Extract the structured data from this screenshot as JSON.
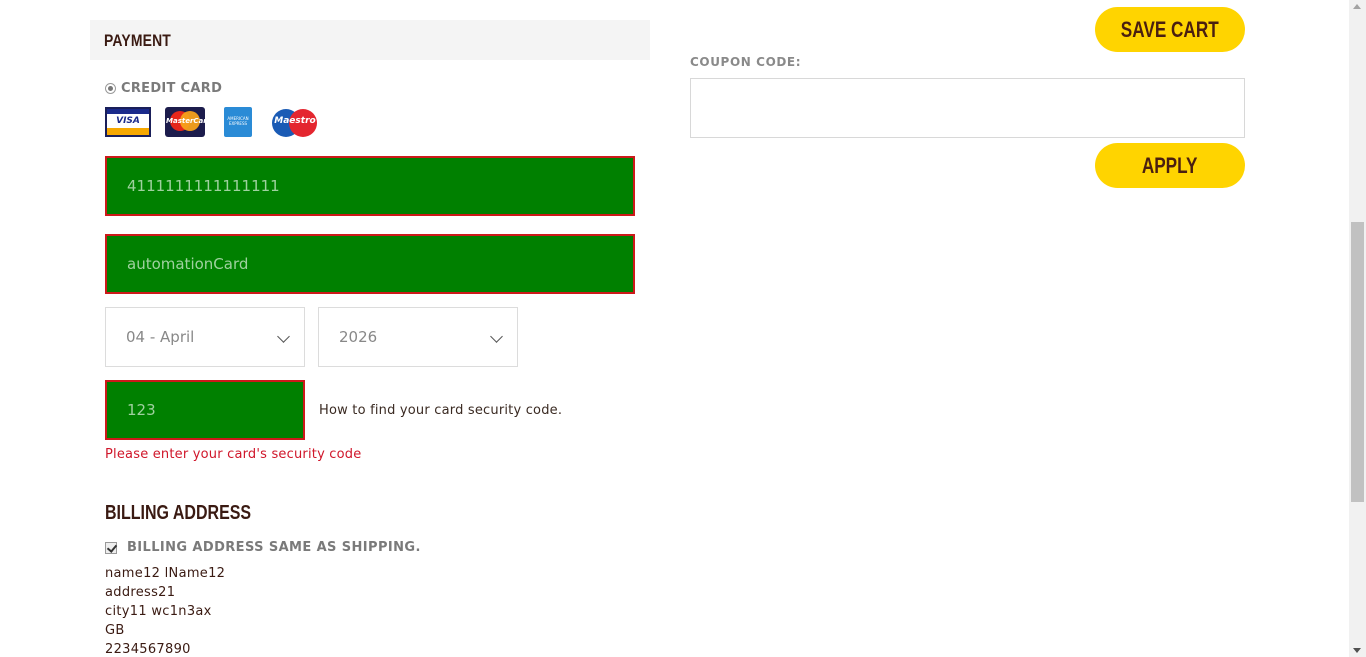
{
  "payment": {
    "header": "PAYMENT",
    "method_label": "CREDIT CARD",
    "card_logos": {
      "visa": "VISA",
      "mastercard": "MasterCard",
      "amex": "AMERICAN EXPRESS",
      "maestro": "Maestro"
    },
    "card_number_value": "4111111111111111",
    "card_name_value": "automationCard",
    "expiry_month_value": "04 - April",
    "expiry_year_value": "2026",
    "cvv_value": "123",
    "cvv_help_link": "How to find your card security code.",
    "cvv_error": "Please enter your card's security code"
  },
  "billing": {
    "title": "BILLING ADDRESS",
    "same_as_shipping_label": "BILLING ADDRESS SAME AS SHIPPING.",
    "address_lines": {
      "name": "name12 lName12",
      "line1": "address21",
      "city_postcode": "city11 wc1n3ax",
      "country": "GB",
      "phone": "2234567890"
    }
  },
  "cart": {
    "save_cart_label": "SAVE CART",
    "coupon_label": "COUPON CODE:",
    "coupon_value": "",
    "apply_label": "APPLY"
  },
  "colors": {
    "accent_yellow": "#ffd400",
    "field_valid_bg": "#008000",
    "field_error_border": "#cc1a1a",
    "error_text": "#d0162a"
  }
}
